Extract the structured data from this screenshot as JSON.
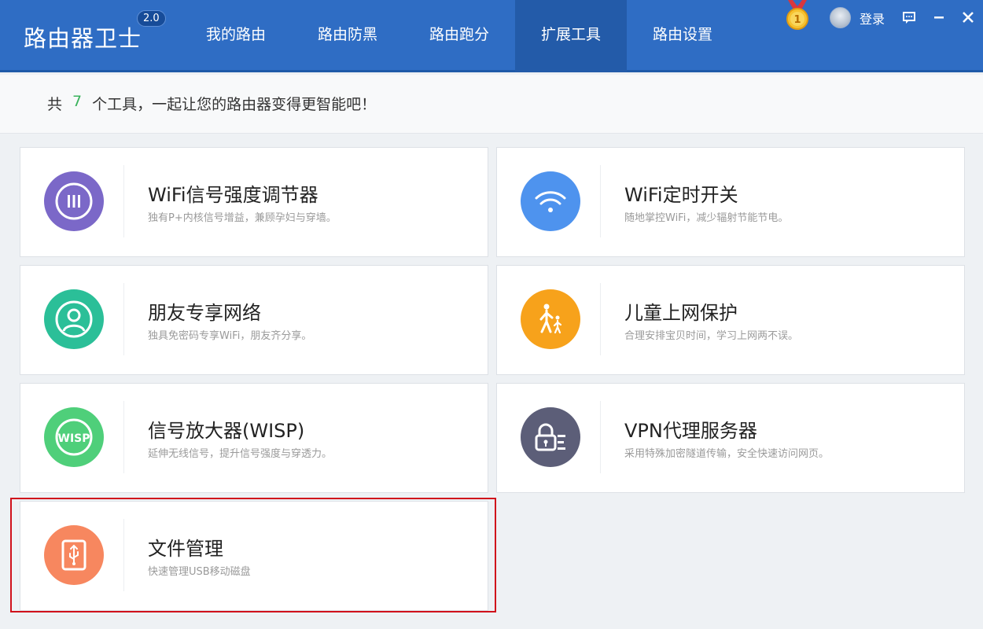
{
  "app": {
    "name": "路由器卫士",
    "version": "2.0"
  },
  "nav": [
    {
      "label": "我的路由",
      "active": false
    },
    {
      "label": "路由防黑",
      "active": false
    },
    {
      "label": "路由跑分",
      "active": false
    },
    {
      "label": "扩展工具",
      "active": true
    },
    {
      "label": "路由设置",
      "active": false
    }
  ],
  "account": {
    "login_label": "登录"
  },
  "window_controls": [
    "feedback-icon",
    "minimize-icon",
    "close-icon"
  ],
  "summary": {
    "prefix": "共",
    "count": "7",
    "suffix": "个工具，一起让您的路由器变得更智能吧！"
  },
  "tools": [
    {
      "title": "WiFi信号强度调节器",
      "desc": "独有P+内核信号增益，兼顾孕妇与穿墙。",
      "icon": "signal-strength-icon",
      "color": "#7b68c8"
    },
    {
      "title": "WiFi定时开关",
      "desc": "随地掌控WiFi，减少辐射节能节电。",
      "icon": "wifi-icon",
      "color": "#4e93ee"
    },
    {
      "title": "朋友专享网络",
      "desc": "独具免密码专享WiFi，朋友齐分享。",
      "icon": "user-icon",
      "color": "#2bbf98"
    },
    {
      "title": "儿童上网保护",
      "desc": "合理安排宝贝时间，学习上网两不误。",
      "icon": "child-protection-icon",
      "color": "#f7a21b"
    },
    {
      "title": "信号放大器(WISP)",
      "desc": "延伸无线信号，提升信号强度与穿透力。",
      "icon": "wisp-icon",
      "color": "#4fcf7a"
    },
    {
      "title": "VPN代理服务器",
      "desc": "采用特殊加密隧道传输，安全快速访问网页。",
      "icon": "vpn-lock-icon",
      "color": "#5c5e78"
    },
    {
      "title": "文件管理",
      "desc": "快速管理USB移动磁盘",
      "icon": "usb-file-icon",
      "color": "#f7875f"
    }
  ],
  "icon_labels": {
    "wisp": "WISP"
  }
}
